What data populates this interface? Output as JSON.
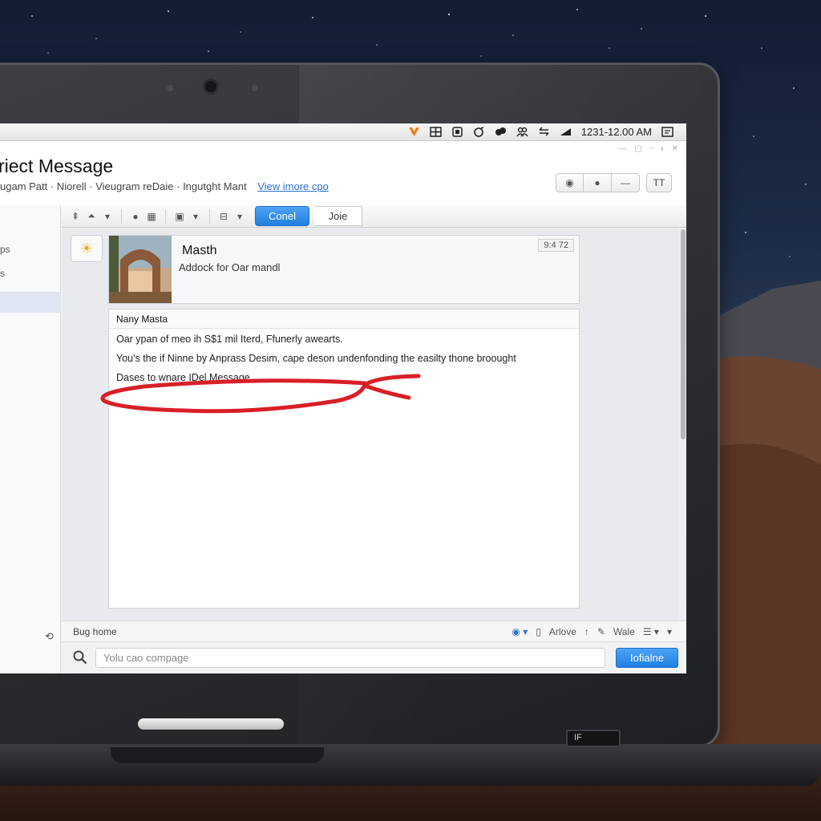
{
  "menubar": {
    "time": "1231-12.00 AM",
    "icons": [
      "vivaldi-icon",
      "grid-icon",
      "bluetooth-icon",
      "wifi-icon",
      "dropbox-icon",
      "people-icon",
      "airplay-icon",
      "display-icon",
      "notification-icon"
    ]
  },
  "header": {
    "title": "riect Message",
    "subtitle": "ugam Patt · Niorell · Vieugram reDaie · Ingutght Mant",
    "link": "View imore cpo",
    "buttons": [
      "help-icon",
      "settings-icon",
      "more-icon"
    ],
    "solo_button": "TT"
  },
  "sidebar": {
    "items": [
      "ps",
      "s"
    ]
  },
  "toolbar": {
    "primary": "Conel",
    "secondary": "Joie",
    "icons": [
      "move-icon",
      "users-icon",
      "apple-icon",
      "calendar-icon",
      "phone-icon",
      "attach-icon"
    ]
  },
  "card": {
    "name": "Masth",
    "description": "Addock for Oar mandl",
    "time": "9:4 72"
  },
  "message": {
    "sender": "Nany Masta",
    "lines": [
      "Oar ypan of meo ih S$1 mil Iterd, Ffunerly awearts.",
      "You's the if Ninne by Anprass Desim, cape deson undenfonding the easilty thone broought",
      "Dases to wnare IDel Message"
    ]
  },
  "actionbar": {
    "left": "Bug home",
    "archive": "Arlove",
    "write": "Wale"
  },
  "compose": {
    "placeholder": "Yolu cao compage",
    "send": "Iofialne"
  },
  "colors": {
    "accent": "#1f7fe0",
    "annotation": "#d81f26"
  }
}
